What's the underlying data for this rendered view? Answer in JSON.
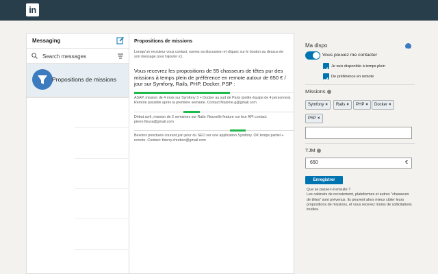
{
  "app": {
    "logo_text": "in"
  },
  "messaging": {
    "title": "Messaging",
    "search_placeholder": "Search messages",
    "conversations": [
      {
        "name": "Propositions de missions"
      }
    ]
  },
  "thread": {
    "title": "Propositions de missions",
    "intro": "Lorsqu'un recruteur vous contact, ouvrez sa discussion et cliquez sur le bouton au dessus de son message pour l'ajouter ici.",
    "summary": "Vous recevrez les propositions de 55 chasseurs de têtes pur des missions à temps plein de préférence en remote autour de 650 € / jour sur Symfony, Rails, PHP, Docker, PSP :",
    "missions": [
      {
        "text": "ASAP, mission de 4 mois sur Symfony 3 + Docker au sud de Paris (petite équipe de 4 personnes). Remote possible après la première semaine. Contact Maxime.g@gmail.com",
        "progress_start": 0.0,
        "progress_end": 0.6
      },
      {
        "text": "Début avril, mission de 2 semaines sur Rails: Nouvelle feature sur leur API contact: pierre.fleura@gmail.com",
        "progress_start": 0.31,
        "progress_end": 0.41
      },
      {
        "text": "Besoins ponctuels courant juin pour du SEO sur une application Symfony. OK temps partiel + remote. Contact: thierry.chretien@gmail.com",
        "progress_start": 0.6,
        "progress_end": 0.7
      }
    ]
  },
  "dispo": {
    "title": "Ma dispo",
    "toggle_label": "Vous pouvez me contacter",
    "toggle_on": true,
    "options": [
      {
        "label": "Je suis disponible à temps plein",
        "checked": true
      },
      {
        "label": "De préférence en remote",
        "checked": true
      }
    ]
  },
  "missions": {
    "label": "Missions",
    "tags": [
      "Symfony",
      "Rails",
      "PHP",
      "Docker",
      "PSP"
    ],
    "input_value": ""
  },
  "tjm": {
    "label": "TJM",
    "value": "650",
    "currency": "€"
  },
  "save_button": "Enregistrer",
  "help": {
    "title": "Que se passe-t-il ensuite ?",
    "body": "Les cabinets de recrutement, plateformes et autres \"chasseurs de têtes\" sont prévenus. Ils peuvent alors mieux cibler leurs propositions de missions, et vous recevez moins de sollicitations inutiles."
  },
  "colors": {
    "topbar": "#283e4a",
    "accent": "#0073b1",
    "progress": "#21b94a"
  },
  "icons": [
    "compose-icon",
    "search-icon",
    "filter-icon",
    "funnel-icon",
    "chevron-down-icon",
    "info-icon",
    "check-icon"
  ]
}
